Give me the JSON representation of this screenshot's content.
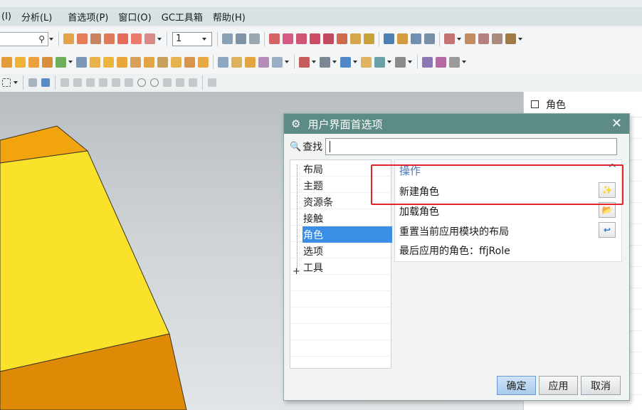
{
  "menu": {
    "items": [
      "(I)",
      "分析(L)",
      "首选项(P)",
      "窗口(O)",
      "GC工具箱",
      "帮助(H)"
    ]
  },
  "toolbar": {
    "combo_value": "1",
    "search_icon": "magnifier-icon"
  },
  "right_panel": {
    "header": "角色"
  },
  "dialog": {
    "title": "用户界面首选项",
    "find_label": "查找",
    "find_value": "",
    "tree": {
      "items": [
        {
          "label": "布局",
          "selected": false
        },
        {
          "label": "主题",
          "selected": false
        },
        {
          "label": "资源条",
          "selected": false
        },
        {
          "label": "接触",
          "selected": false
        },
        {
          "label": "角色",
          "selected": true
        },
        {
          "label": "选项",
          "selected": false
        },
        {
          "label": "工具",
          "selected": false,
          "expandable": true
        }
      ],
      "expand_symbol": "+"
    },
    "section": {
      "title": "操作",
      "actions": [
        {
          "label": "新建角色",
          "icon": "new-role-icon"
        },
        {
          "label": "加载角色",
          "icon": "load-role-icon"
        },
        {
          "label": "重置当前应用模块的布局",
          "icon": "reset-layout-icon"
        }
      ],
      "last_role": "最后应用的角色：ffjRole"
    },
    "buttons": {
      "ok": "确定",
      "apply": "应用",
      "cancel": "取消"
    }
  },
  "colors": {
    "title_bar": "#5d8b85",
    "selection": "#3a8ee6",
    "highlight": "#e0262b",
    "shape_yellow": "#fbe22a",
    "shape_orange": "#f2a40e"
  }
}
